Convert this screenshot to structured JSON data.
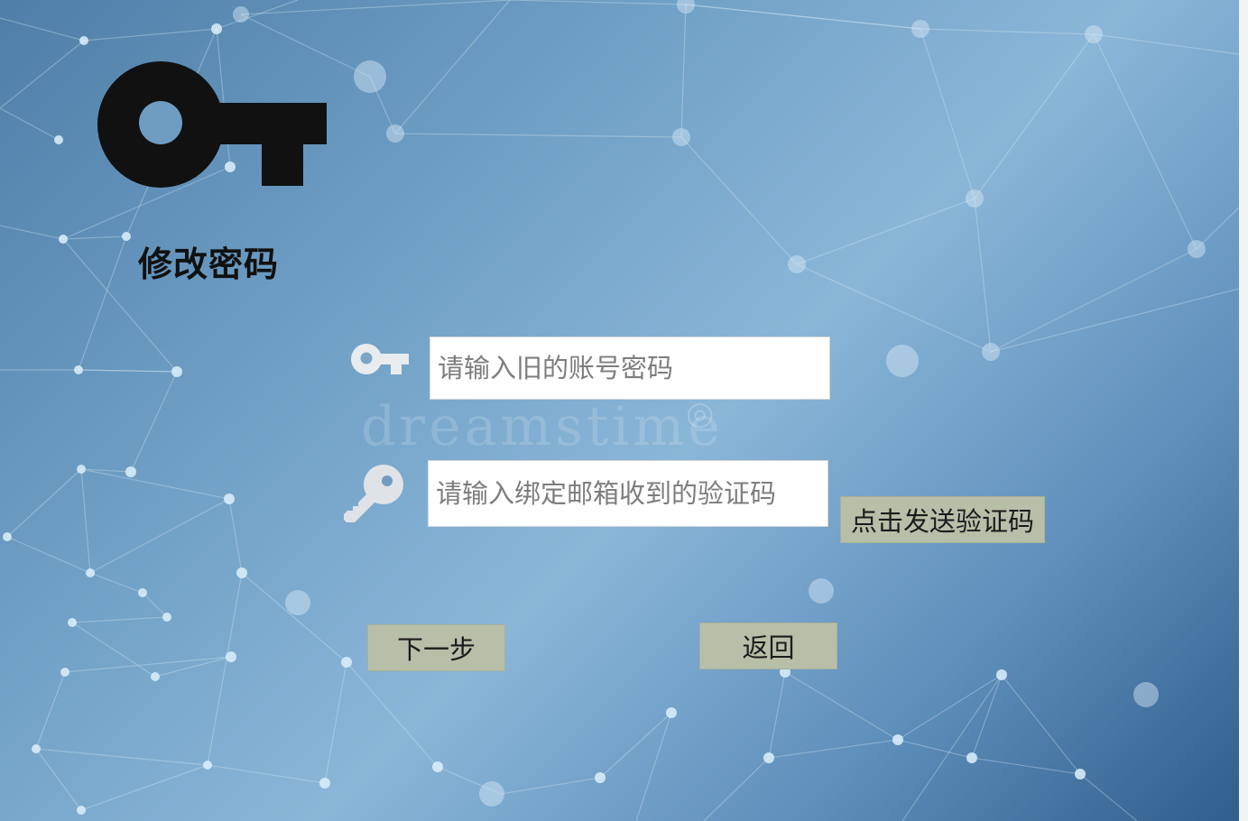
{
  "page": {
    "title": "修改密码",
    "watermark": "dreamstime"
  },
  "icons": {
    "header": "key-icon",
    "old_password": "key-icon",
    "verification_code": "key-icon"
  },
  "old_password": {
    "placeholder": "请输入旧的账号密码"
  },
  "verification_code": {
    "placeholder": "请输入绑定邮箱收到的验证码"
  },
  "buttons": {
    "send_code": "点击发送验证码",
    "next": "下一步",
    "back": "返回"
  },
  "colors": {
    "button_bg": "#b8bfa8",
    "icon_dark": "#111111",
    "icon_light": "#dfe3e8"
  }
}
